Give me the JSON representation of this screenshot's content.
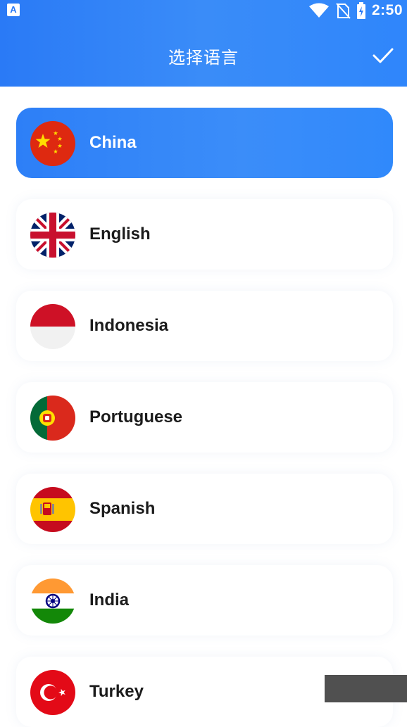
{
  "status_bar": {
    "app_icon": "A",
    "time": "2:50",
    "icons": [
      "wifi-icon",
      "no-sim-icon",
      "battery-charging-icon"
    ]
  },
  "header": {
    "title": "选择语言",
    "confirm_icon": "check-icon"
  },
  "languages": [
    {
      "label": "China",
      "flag": "china-flag-icon",
      "selected": true
    },
    {
      "label": "English",
      "flag": "uk-flag-icon",
      "selected": false
    },
    {
      "label": "Indonesia",
      "flag": "indonesia-flag-icon",
      "selected": false
    },
    {
      "label": "Portuguese",
      "flag": "portugal-flag-icon",
      "selected": false
    },
    {
      "label": "Spanish",
      "flag": "spain-flag-icon",
      "selected": false
    },
    {
      "label": "India",
      "flag": "india-flag-icon",
      "selected": false
    },
    {
      "label": "Turkey",
      "flag": "turkey-flag-icon",
      "selected": false
    }
  ],
  "colors": {
    "accent": "#2d7ff7",
    "text": "#1b1b1b",
    "selected_text": "#ffffff"
  }
}
